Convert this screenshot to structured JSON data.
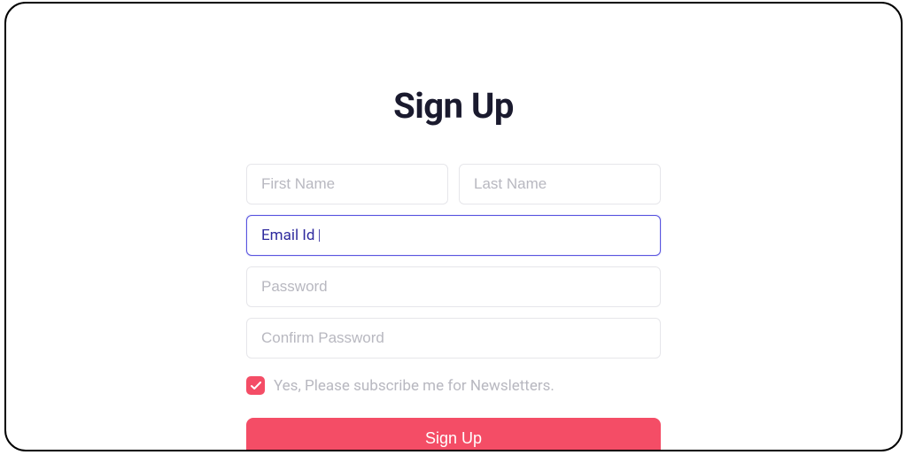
{
  "title": "Sign Up",
  "fields": {
    "first_name_placeholder": "First Name",
    "last_name_placeholder": "Last Name",
    "email_placeholder": "Email Id",
    "email_value": "Email Id",
    "password_placeholder": "Password",
    "confirm_password_placeholder": "Confirm Password"
  },
  "newsletter": {
    "checked": true,
    "label": "Yes, Please subscribe me for Newsletters."
  },
  "submit_label": "Sign Up",
  "colors": {
    "accent": "#f44d66",
    "active_border": "#5a55e0",
    "placeholder": "#b8b8c0",
    "heading": "#1a1a2e"
  }
}
